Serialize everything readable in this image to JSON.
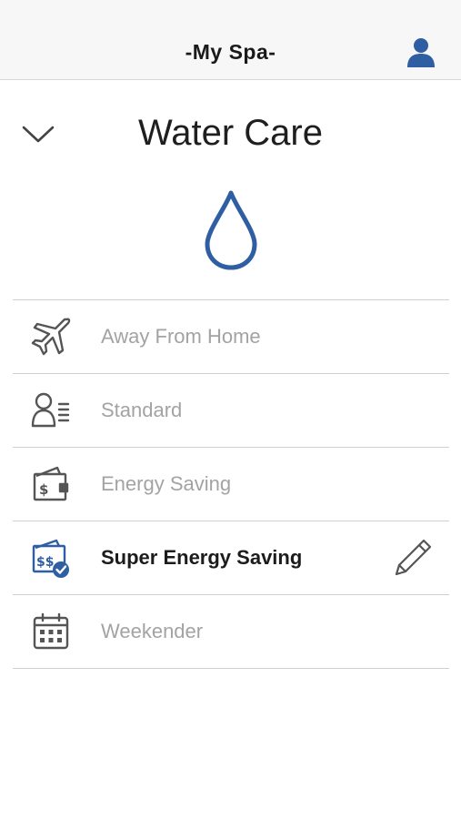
{
  "header": {
    "title": "-My Spa-",
    "profile_icon": "person-icon"
  },
  "section": {
    "title": "Water Care",
    "collapse_icon": "chevron-down-icon",
    "hero_icon": "water-drop-icon"
  },
  "colors": {
    "accent": "#2f5ea3",
    "icon_gray": "#666666",
    "label_inactive": "#a3a3a3",
    "label_active": "#1c1c1c",
    "divider": "#d0d0d0",
    "header_bg": "#f7f7f7"
  },
  "modes": [
    {
      "label": "Away From Home",
      "icon": "airplane-icon",
      "selected": false
    },
    {
      "label": "Standard",
      "icon": "person-list-icon",
      "selected": false
    },
    {
      "label": "Energy Saving",
      "icon": "wallet-dollar-icon",
      "selected": false
    },
    {
      "label": "Super Energy Saving",
      "icon": "money-check-icon",
      "selected": true,
      "edit_icon": "pencil-icon"
    },
    {
      "label": "Weekender",
      "icon": "calendar-icon",
      "selected": false
    }
  ]
}
